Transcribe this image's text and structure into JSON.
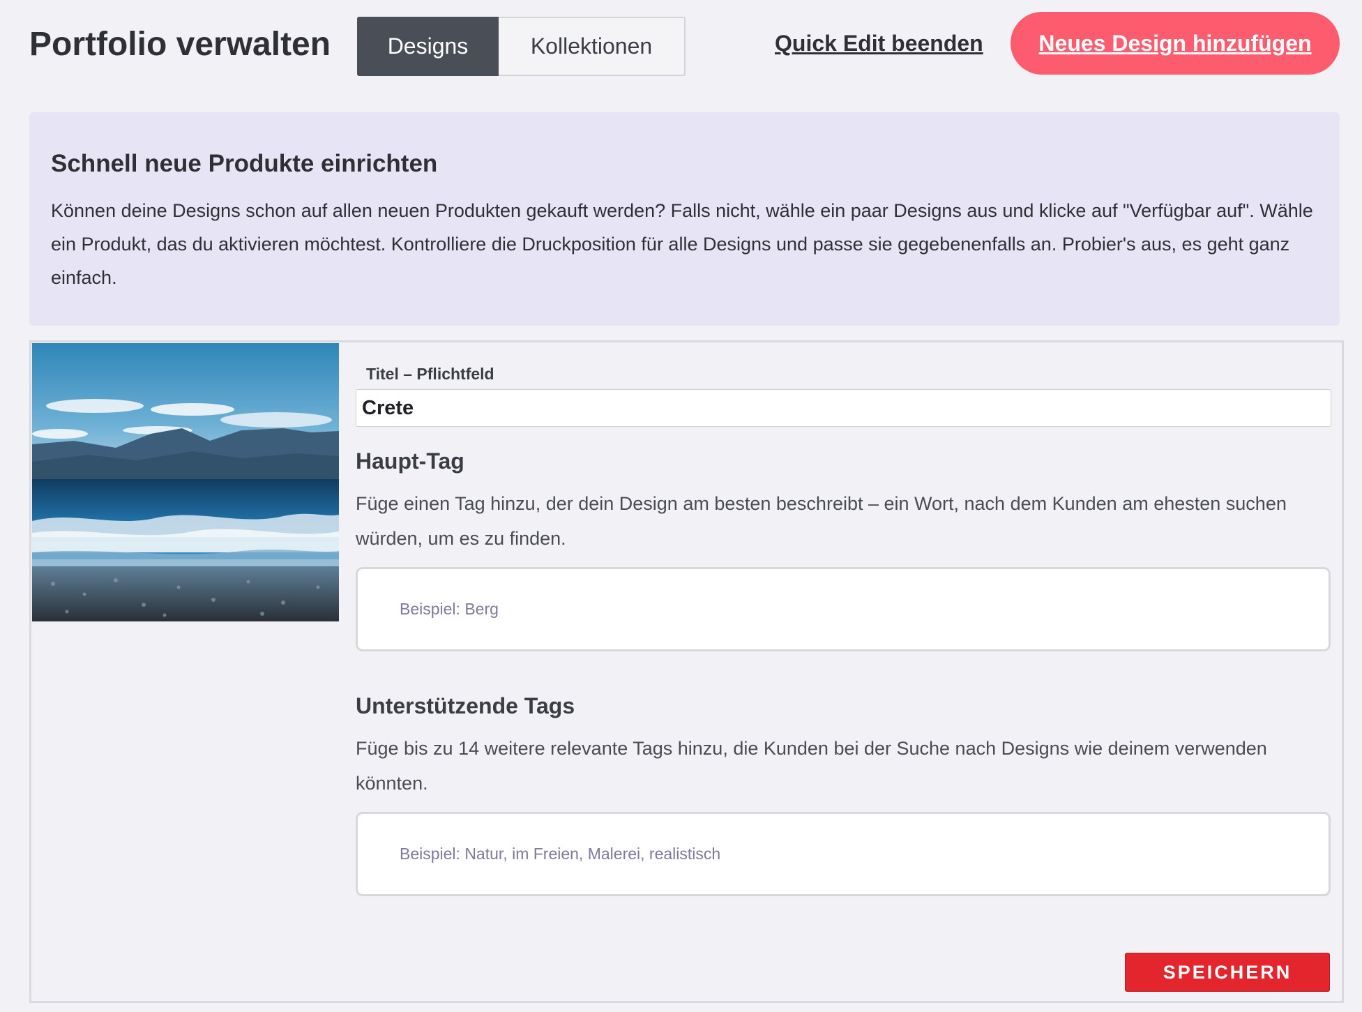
{
  "header": {
    "title": "Portfolio verwalten",
    "tabs": [
      {
        "label": "Designs",
        "active": true
      },
      {
        "label": "Kollektionen",
        "active": false
      }
    ],
    "quick_edit_label": "Quick Edit beenden",
    "add_design_label": "Neues Design hinzufügen"
  },
  "banner": {
    "title": "Schnell neue Produkte einrichten",
    "text": "Können deine Designs schon auf allen neuen Produkten gekauft werden? Falls nicht, wähle ein paar Designs aus und klicke auf \"Verfügbar auf\". Wähle ein Produkt, das du aktivieren möchtest. Kontrolliere die Druckposition für alle Designs und passe sie gegebenenfalls an. Probier's aus, es geht ganz einfach."
  },
  "design": {
    "title_label": "Titel – Pflichtfeld",
    "title_value": "Crete",
    "main_tag": {
      "heading": "Haupt-Tag",
      "description": "Füge einen Tag hinzu, der dein Design am besten beschreibt – ein Wort, nach dem Kunden am ehesten suchen würden, um es zu finden.",
      "placeholder": "Beispiel: Berg"
    },
    "supporting_tags": {
      "heading": "Unterstützende Tags",
      "description": "Füge bis zu 14 weitere relevante Tags hinzu, die Kunden bei der Suche nach Designs wie deinem verwenden könnten.",
      "placeholder": "Beispiel: Natur, im Freien, Malerei, realistisch"
    },
    "save_label": "SPEICHERN"
  },
  "colors": {
    "accent": "#fc5c6e",
    "save": "#e3262e",
    "tab_active": "#4a4e57",
    "banner_bg": "#e7e4f6"
  }
}
